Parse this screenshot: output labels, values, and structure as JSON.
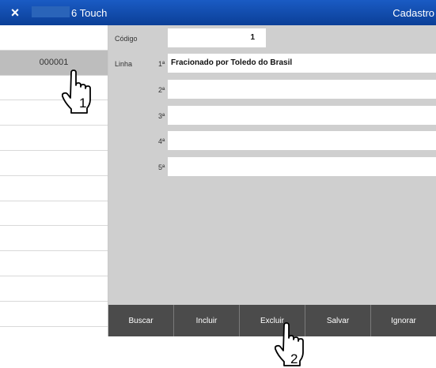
{
  "titlebar": {
    "close_label": "×",
    "app_name": "6 Touch",
    "screen_name": "Cadastro"
  },
  "sidebar": {
    "rows": [
      "",
      "000001",
      "",
      "",
      "",
      "",
      "",
      "",
      "",
      "",
      "",
      ""
    ]
  },
  "form": {
    "codigo_label": "Código",
    "codigo_value": "1",
    "linha_label": "Linha",
    "lines": [
      {
        "num": "1ª",
        "value": "Fracionado por Toledo do Brasil"
      },
      {
        "num": "2ª",
        "value": ""
      },
      {
        "num": "3ª",
        "value": ""
      },
      {
        "num": "4ª",
        "value": ""
      },
      {
        "num": "5ª",
        "value": ""
      }
    ]
  },
  "toolbar": {
    "buttons": [
      "Buscar",
      "Incluir",
      "Excluir",
      "Salvar",
      "Ignorar"
    ]
  },
  "annotations": {
    "step1": "1",
    "step2": "2"
  },
  "colors": {
    "titlebar": "#0b3f97",
    "panel": "#cfcfcf",
    "selected_row": "#bdbdbd",
    "toolbar": "#4b4b4b"
  },
  "icons": [
    "close-icon",
    "hand-cursor-icon"
  ]
}
